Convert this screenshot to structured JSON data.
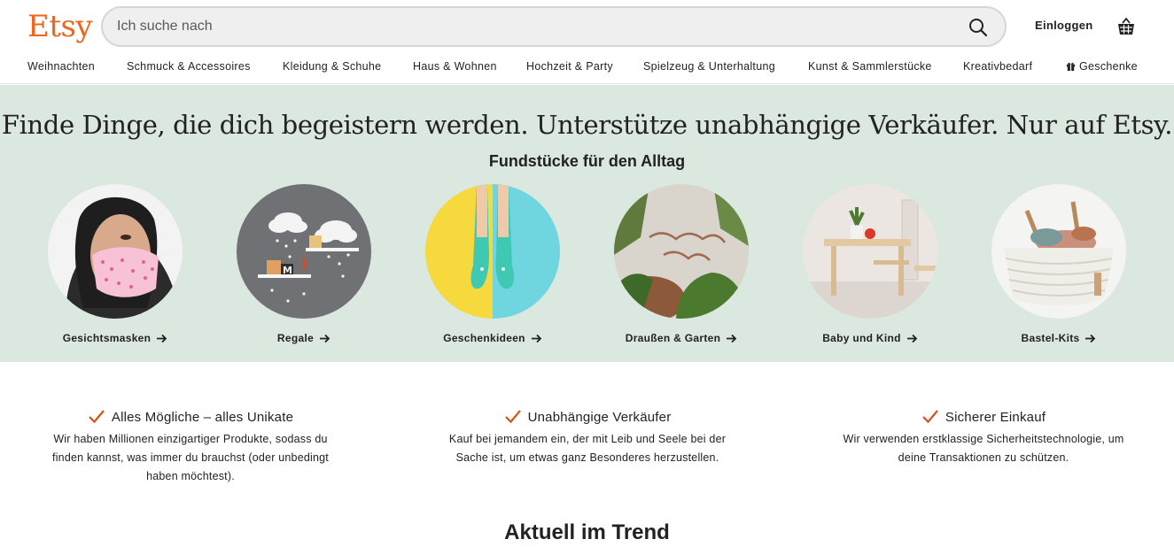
{
  "header": {
    "logo": "Etsy",
    "search_placeholder": "Ich suche nach",
    "login_label": "Einloggen"
  },
  "nav": {
    "items": [
      "Weihnachten",
      "Schmuck & Accessoires",
      "Kleidung & Schuhe",
      "Haus & Wohnen",
      "Hochzeit & Party",
      "Spielzeug & Unterhaltung",
      "Kunst & Sammlerstücke",
      "Kreativbedarf",
      "Geschenke"
    ]
  },
  "hero": {
    "tagline": "Finde Dinge, die dich begeistern werden. Unterstütze unabhängige Verkäufer. Nur auf Etsy.",
    "subhead": "Fundstücke für den Alltag",
    "categories": [
      "Gesichtsmasken",
      "Regale",
      "Geschenkideen",
      "Draußen & Garten",
      "Baby und Kind",
      "Bastel-Kits"
    ]
  },
  "values": [
    {
      "title": "Alles Mögliche – alles Unikate",
      "text": "Wir haben Millionen einzigartiger Produkte, sodass du finden kannst, was immer du brauchst (oder unbedingt haben möchtest)."
    },
    {
      "title": "Unabhängige Verkäufer",
      "text": "Kauf bei jemandem ein, der mit Leib und Seele bei der Sache ist, um etwas ganz Besonderes herzustellen."
    },
    {
      "title": "Sicherer Einkauf",
      "text": "Wir verwenden erstklassige Sicherheitstechnologie, um deine Transaktionen zu schützen."
    }
  ],
  "trend": {
    "title": "Aktuell im Trend"
  },
  "colors": {
    "brand": "#F1641E",
    "hero_bg": "#dbe8df",
    "check": "#D5521B"
  }
}
